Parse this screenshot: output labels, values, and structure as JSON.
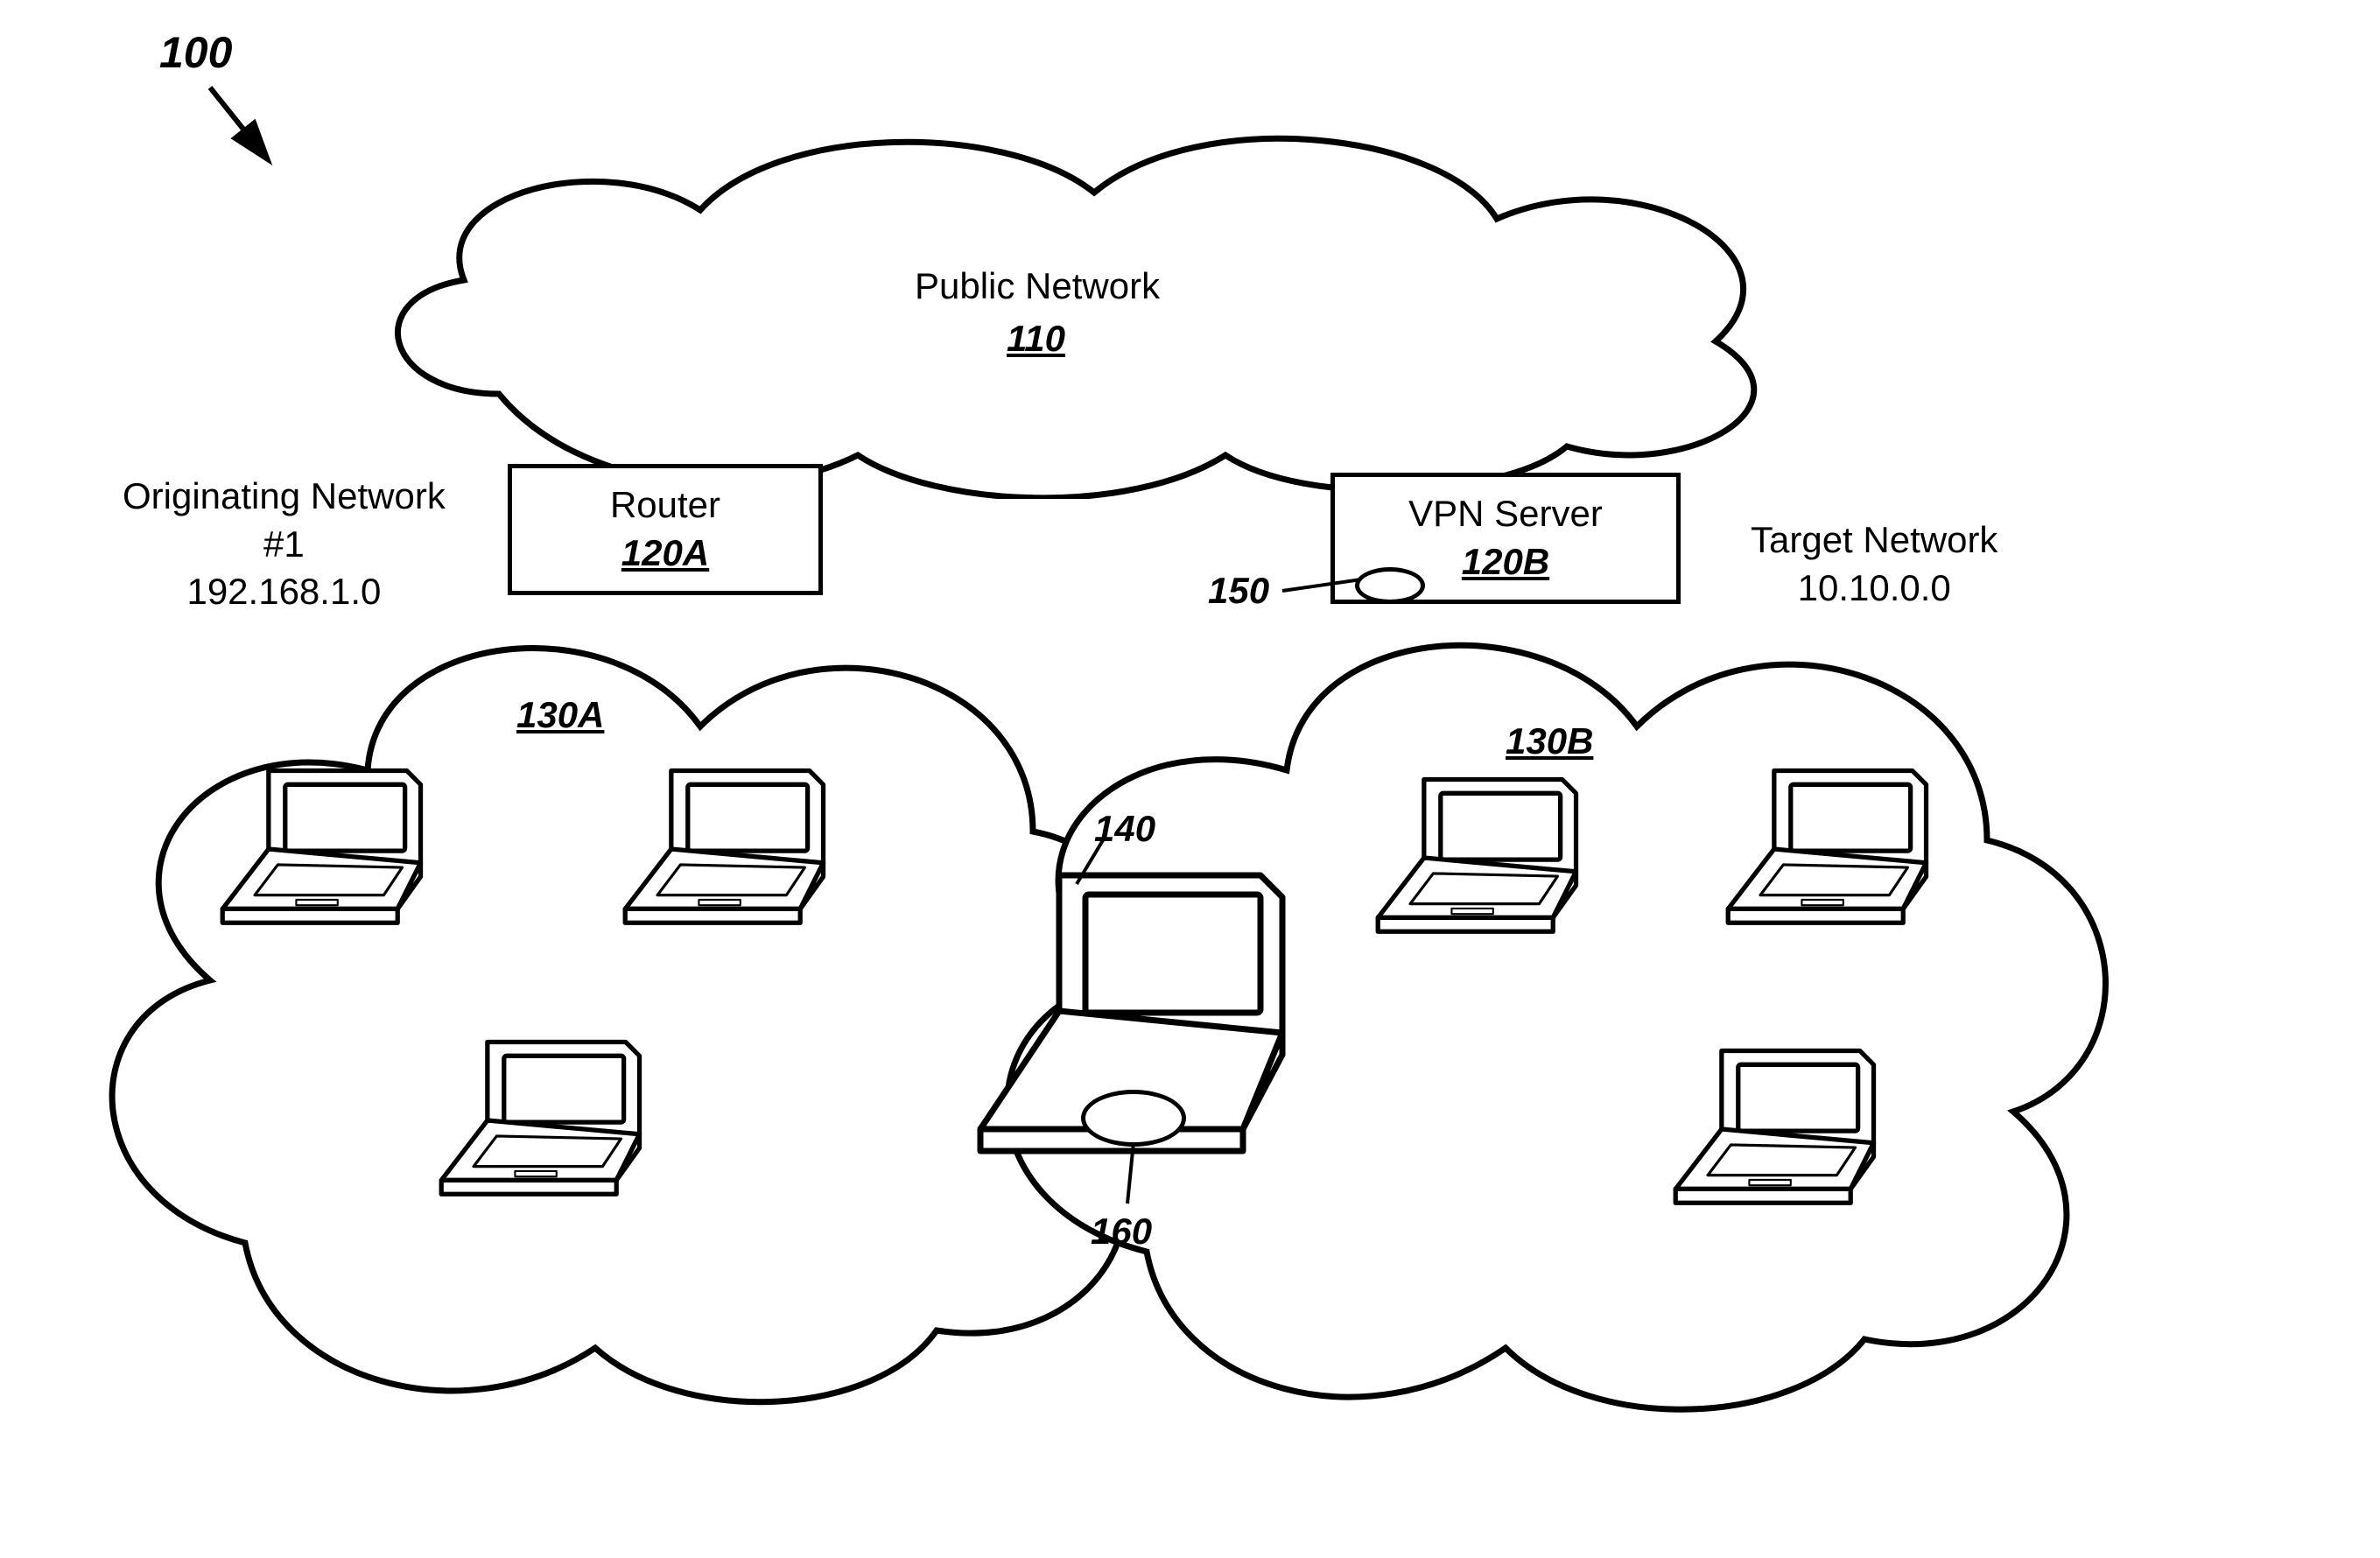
{
  "figure_ref": "100",
  "public_network": {
    "title": "Public Network",
    "ref": "110"
  },
  "router": {
    "title": "Router",
    "ref": "120A"
  },
  "vpn": {
    "title": "VPN Server",
    "ref": "120B",
    "marker_ref": "150"
  },
  "originating": {
    "label": "Originating Network\n#1\n192.168.1.0",
    "cloud_ref": "130A"
  },
  "target": {
    "label": "Target Network\n10.10.0.0",
    "cloud_ref": "130B"
  },
  "center_laptop": {
    "ref": "140",
    "marker_ref": "160"
  }
}
